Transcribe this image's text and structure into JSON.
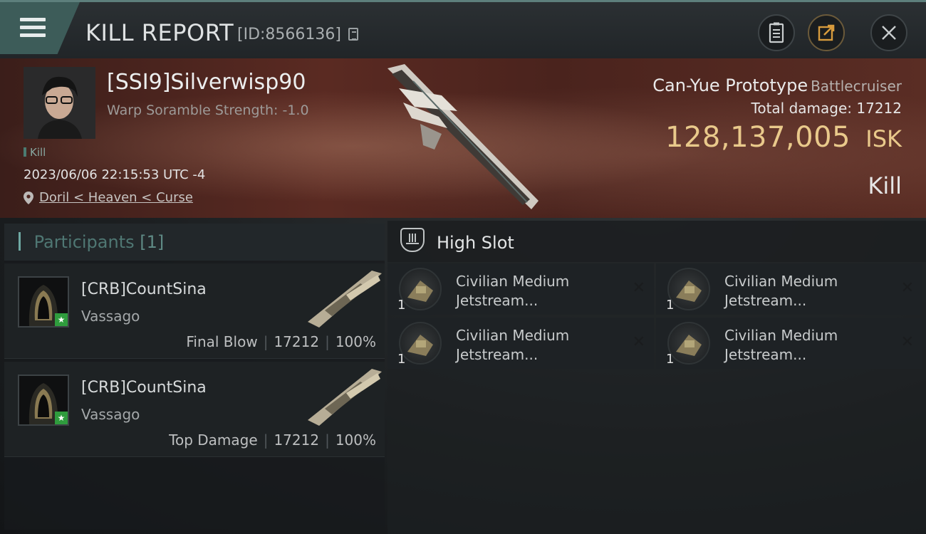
{
  "header": {
    "title": "KILL REPORT",
    "report_id": "[ID:8566136]",
    "icons": [
      "menu-icon",
      "copy-icon",
      "clipboard-icon",
      "share-icon",
      "close-icon"
    ]
  },
  "victim": {
    "name": "[SSI9]Silverwisp90",
    "warp_scramble": "Warp Soramble Strength: -1.0",
    "tag": "Kill",
    "timestamp": "2023/06/06 22:15:53 UTC -4",
    "location": "Doril < Heaven < Curse",
    "ship_name": "Can-Yue Prototype",
    "ship_class": "Battlecruiser",
    "total_damage_label": "Total damage:",
    "total_damage": "17212",
    "isk_value": "128,137,005",
    "isk_label": "ISK",
    "result": "Kill"
  },
  "participants": {
    "label": "Participants",
    "count": "[1]",
    "rows": [
      {
        "name": "[CRB]CountSina",
        "ship": "Vassago",
        "role": "Final Blow",
        "damage": "17212",
        "percent": "100%"
      },
      {
        "name": "[CRB]CountSina",
        "ship": "Vassago",
        "role": "Top Damage",
        "damage": "17212",
        "percent": "100%"
      }
    ]
  },
  "fitting": {
    "slot_title": "High Slot",
    "items": [
      {
        "line1": "Civilian Medium",
        "line2": "Jetstream...",
        "qty": "1"
      },
      {
        "line1": "Civilian Medium",
        "line2": "Jetstream...",
        "qty": "1"
      },
      {
        "line1": "Civilian Medium",
        "line2": "Jetstream...",
        "qty": "1"
      },
      {
        "line1": "Civilian Medium",
        "line2": "Jetstream...",
        "qty": "1"
      }
    ]
  },
  "colors": {
    "accent_teal": "#3d5c59",
    "isk_gold": "#e9c98b",
    "banner_red": "#5a2a22",
    "star_green": "#2f9c3d"
  }
}
